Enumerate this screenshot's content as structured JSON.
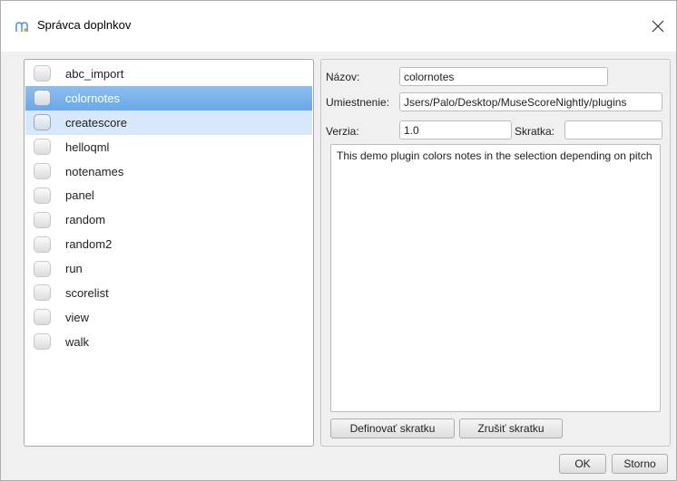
{
  "window": {
    "title": "Správca doplnkov",
    "close_icon": "close-icon"
  },
  "plugins": [
    {
      "name": "abc_import",
      "state": "normal"
    },
    {
      "name": "colornotes",
      "state": "selected"
    },
    {
      "name": "createscore",
      "state": "hover"
    },
    {
      "name": "helloqml",
      "state": "normal"
    },
    {
      "name": "notenames",
      "state": "normal"
    },
    {
      "name": "panel",
      "state": "normal"
    },
    {
      "name": "random",
      "state": "normal"
    },
    {
      "name": "random2",
      "state": "normal"
    },
    {
      "name": "run",
      "state": "normal"
    },
    {
      "name": "scorelist",
      "state": "normal"
    },
    {
      "name": "view",
      "state": "normal"
    },
    {
      "name": "walk",
      "state": "normal"
    }
  ],
  "details": {
    "name_label": "Názov:",
    "name_value": "colornotes",
    "path_label": "Umiestnenie:",
    "path_value": "Jsers/Palo/Desktop/MuseScoreNightly/plugins",
    "version_label": "Verzia:",
    "version_value": "1.0",
    "shortcut_label": "Skratka:",
    "shortcut_value": "",
    "description": "This demo plugin colors notes in the selection depending on pitch",
    "define_shortcut_button": "Definovať skratku",
    "clear_shortcut_button": "Zrušiť skratku"
  },
  "footer": {
    "ok_button": "OK",
    "cancel_button": "Storno"
  },
  "colors": {
    "selected": "#7ab4ee",
    "hover": "#d7e8fa"
  }
}
